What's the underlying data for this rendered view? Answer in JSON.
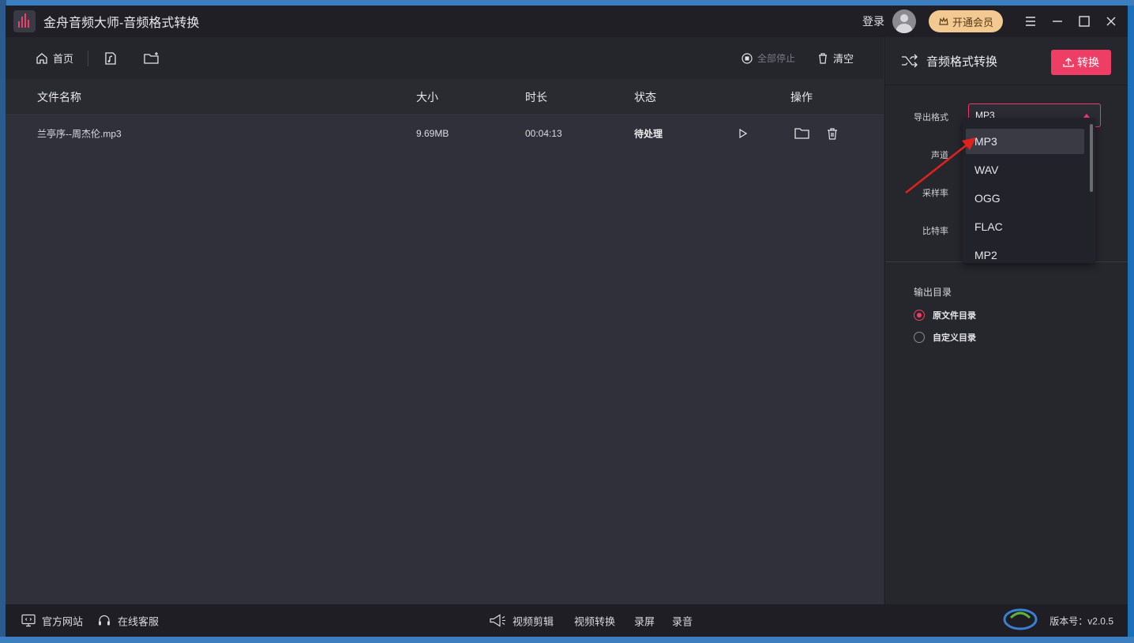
{
  "app": {
    "title": "金舟音频大师-音频格式转换",
    "login": "登录",
    "vip": "开通会员"
  },
  "toolbar": {
    "home": "首页",
    "stop_all": "全部停止",
    "clear": "清空"
  },
  "table": {
    "headers": [
      "文件名称",
      "大小",
      "时长",
      "状态",
      "操作"
    ],
    "rows": [
      {
        "name": "兰亭序--周杰伦.mp3",
        "size": "9.69MB",
        "duration": "00:04:13",
        "status": "待处理"
      }
    ]
  },
  "panel": {
    "title": "音频格式转换",
    "convert": "转换",
    "labels": {
      "format": "导出格式",
      "channel": "声道",
      "sample_rate": "采样率",
      "bitrate": "比特率"
    },
    "format_value": "MP3",
    "format_options": [
      "MP3",
      "WAV",
      "OGG",
      "FLAC",
      "MP2"
    ],
    "output_dir_label": "输出目录",
    "output_options": [
      "原文件目录",
      "自定义目录"
    ],
    "output_selected": "原文件目录"
  },
  "footer": {
    "website": "官方网站",
    "service": "在线客服",
    "tools": [
      "视频剪辑",
      "视频转换",
      "录屏",
      "录音"
    ],
    "version": "版本号：v2.0.5"
  },
  "colors": {
    "accent": "#ee3e66",
    "vip": "#f3c992"
  }
}
